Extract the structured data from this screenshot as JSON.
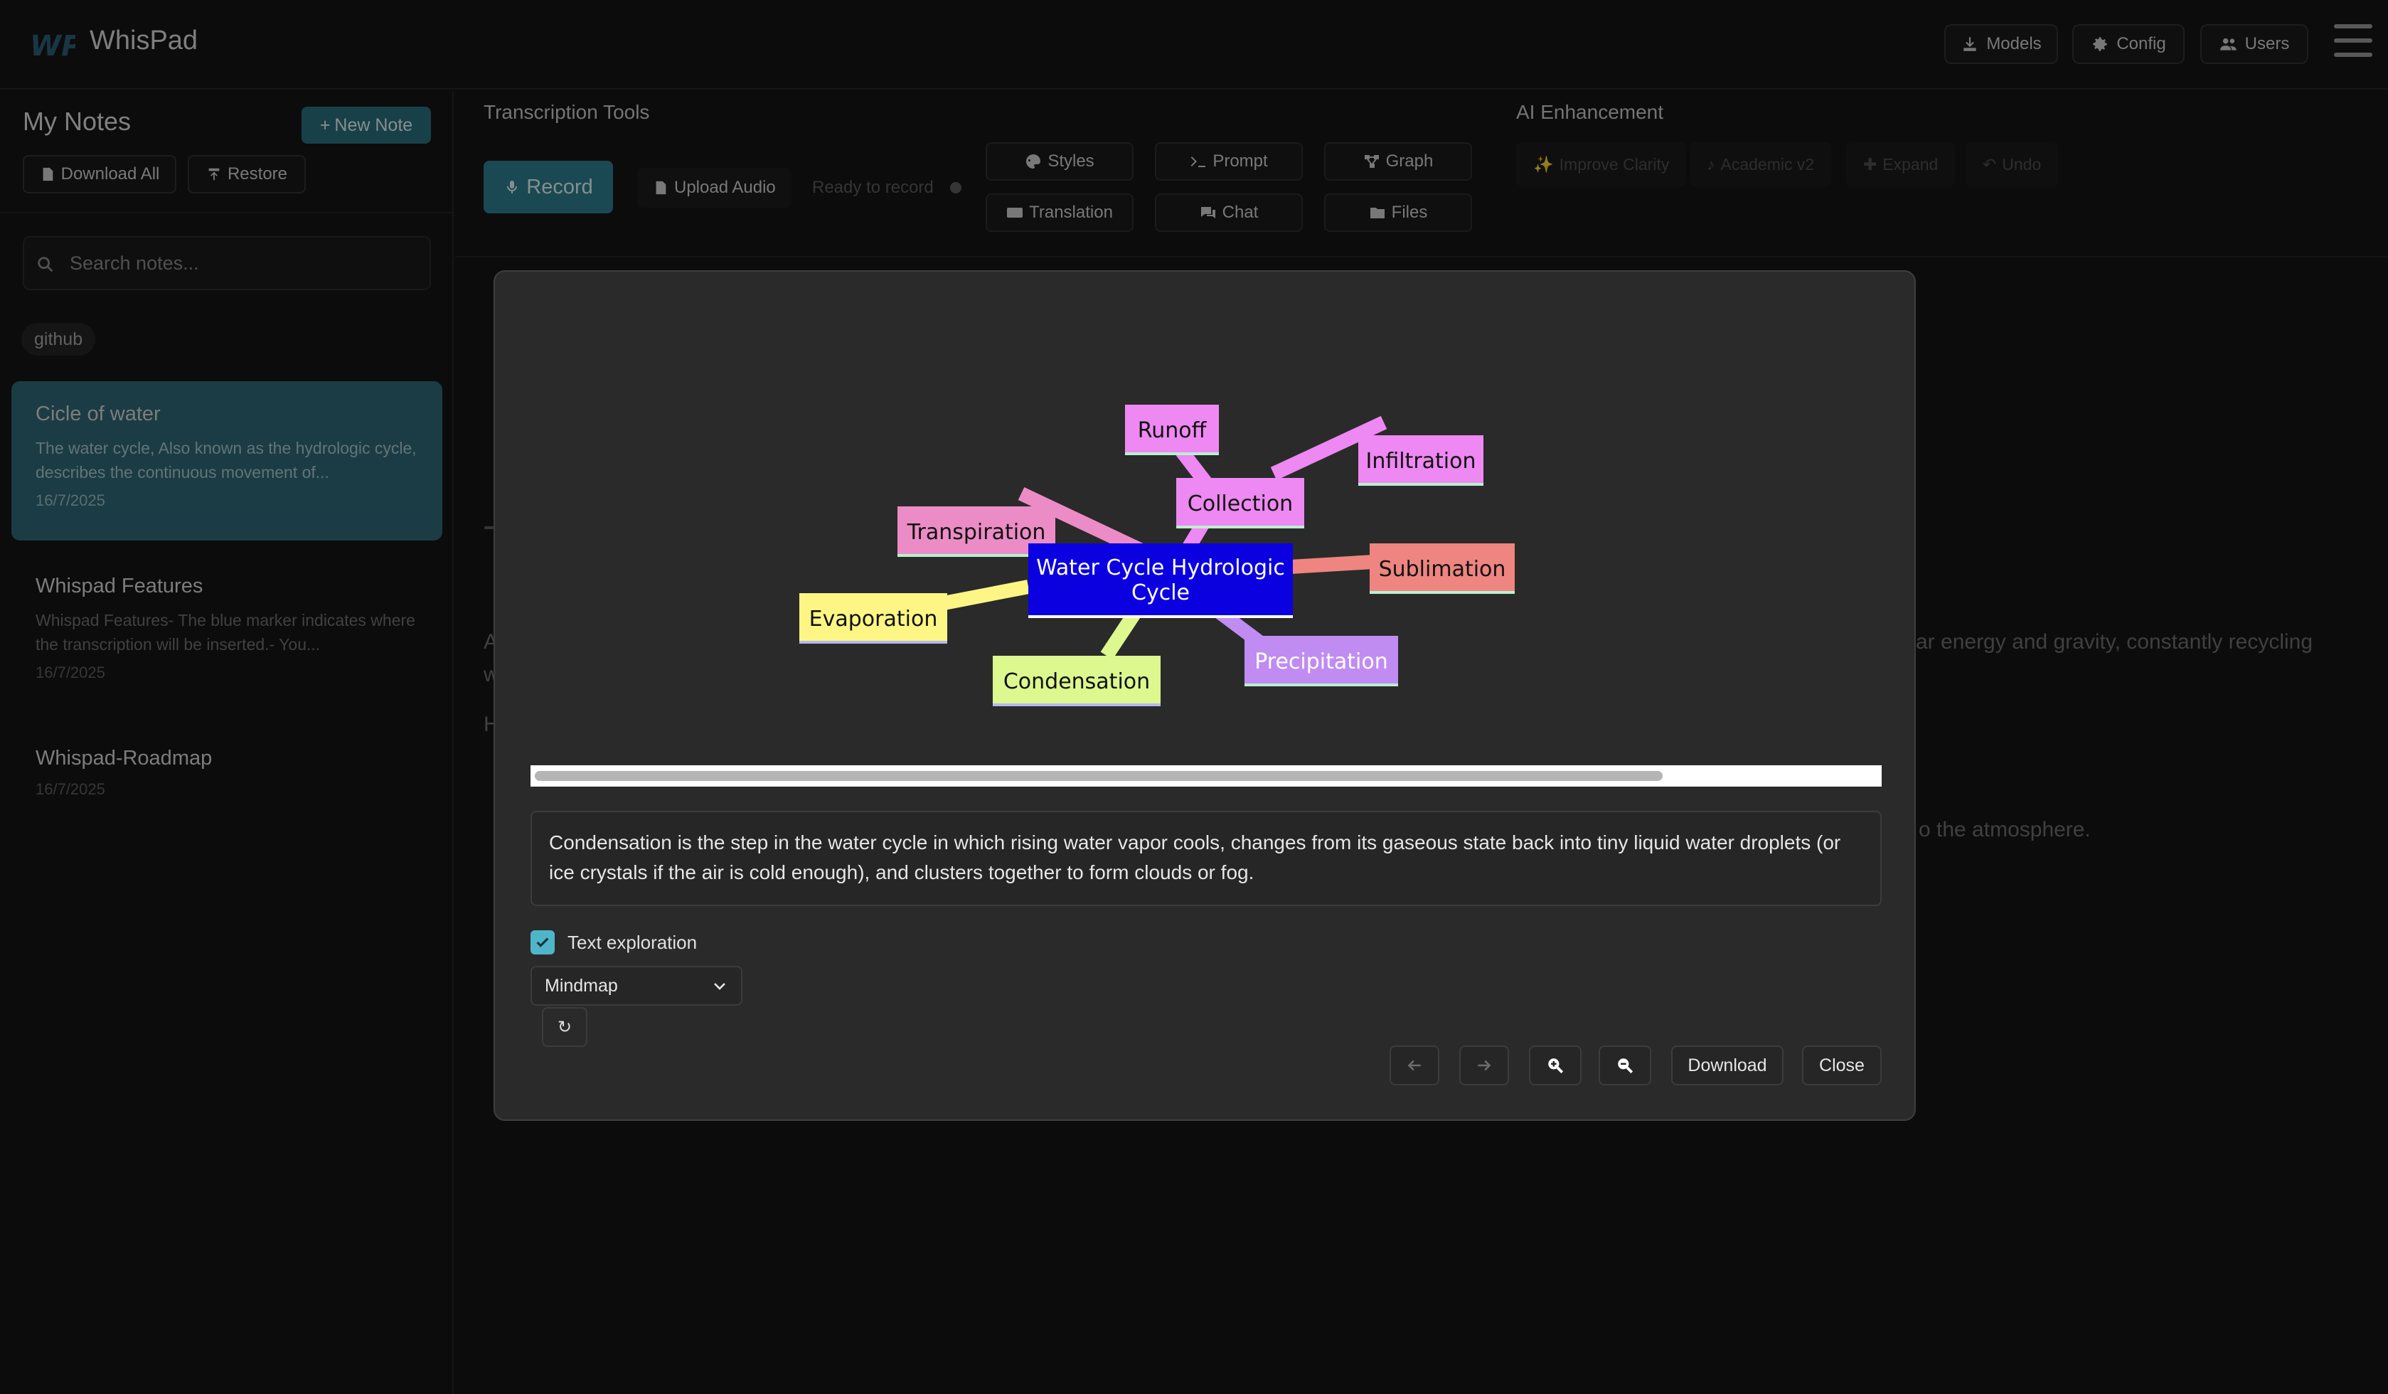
{
  "app": {
    "title": "WhisPad",
    "logo_text": "WP"
  },
  "header": {
    "buttons": {
      "models": "Models",
      "config": "Config",
      "users": "Users"
    }
  },
  "sidebar": {
    "title": "My Notes",
    "new_note": "New Note",
    "download_all": "Download All",
    "restore": "Restore",
    "search_placeholder": "Search notes...",
    "tag": "github",
    "notes": [
      {
        "title": "Cicle of water",
        "snippet": "The water cycle, Also known as the hydrologic cycle, describes the continuous movement of...",
        "date": "16/7/2025",
        "active": true
      },
      {
        "title": "Whispad Features",
        "snippet": "Whispad Features- The blue marker indicates where the transcription will be inserted.- You...",
        "date": "16/7/2025",
        "active": false
      },
      {
        "title": "Whispad-Roadmap",
        "snippet": "",
        "date": "16/7/2025",
        "active": false
      }
    ]
  },
  "main": {
    "transcription_title": "Transcription Tools",
    "record": "Record",
    "upload_audio": "Upload Audio",
    "ready_status": "Ready to record",
    "tools": {
      "styles": "Styles",
      "prompt": "Prompt",
      "graph": "Graph",
      "translation": "Translation",
      "chat": "Chat",
      "files": "Files"
    },
    "ai_title": "AI Enhancement",
    "ai_buttons": {
      "improve_clarity": "Improve Clarity",
      "academic": "Academic v2",
      "expand": "Expand",
      "undo": "Undo"
    },
    "bg_fragments": {
      "heading_letter": "T",
      "line_a_start": "A",
      "line_a_end": "ar energy and gravity, constantly recycling",
      "line_w": "w",
      "line_h": "H",
      "line_b_end": "o the atmosphere."
    }
  },
  "modal": {
    "mindmap": {
      "center": "Water Cycle Hydrologic Cycle",
      "nodes": [
        "Runoff",
        "Infiltration",
        "Collection",
        "Transpiration",
        "Sublimation",
        "Evaporation",
        "Precipitation",
        "Condensation"
      ],
      "colors": {
        "center": "#0b00e0",
        "runoff": "#ee88f2",
        "infiltration": "#ee88f2",
        "collection": "#ee88f2",
        "transpiration": "#ec8cc6",
        "sublimation": "#ef8580",
        "evaporation": "#fdf684",
        "precipitation": "#c08cf2",
        "condensation": "#dcf88e"
      }
    },
    "scroll_position": 0.84,
    "description": "Condensation is the step in the water cycle in which rising water vapor cools, changes from its gaseous state back into tiny liquid water droplets (or ice crystals if the air is cold enough), and clusters together to form clouds or fog.",
    "text_exploration_label": "Text exploration",
    "text_exploration_checked": true,
    "view_select": "Mindmap",
    "refresh_icon": "↻",
    "download": "Download",
    "close": "Close"
  }
}
